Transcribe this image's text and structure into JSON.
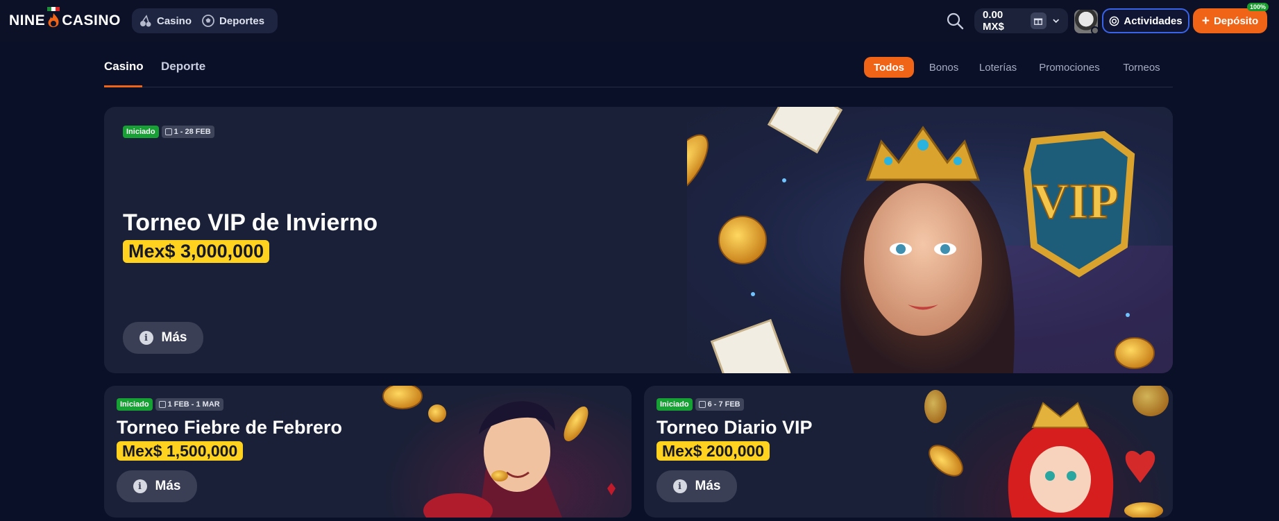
{
  "brand": {
    "logo_left": "NINE",
    "logo_right": "CASINO"
  },
  "topnav": {
    "casino": "Casino",
    "sports": "Deportes"
  },
  "header": {
    "balance": "0.00 MX$",
    "activities": "Actividades",
    "deposit": "Depósito",
    "deposit_badge": "100%"
  },
  "subnav": {
    "tabs": [
      "Casino",
      "Deporte"
    ],
    "filters": [
      "Todos",
      "Bonos",
      "Loterías",
      "Promociones",
      "Torneos"
    ],
    "active_filter": "Todos"
  },
  "cards": [
    {
      "status": "Iniciado",
      "dates": "1 - 28 FEB",
      "title": "Torneo VIP de Invierno",
      "prize": "Mex$ 3,000,000",
      "button": "Más"
    },
    {
      "status": "Iniciado",
      "dates": "1 FEB - 1 MAR",
      "title": "Torneo Fiebre de Febrero",
      "prize": "Mex$ 1,500,000",
      "button": "Más"
    },
    {
      "status": "Iniciado",
      "dates": "6 - 7 FEB",
      "title": "Torneo Diario VIP",
      "prize": "Mex$ 200,000",
      "button": "Más"
    }
  ],
  "hero_art": {
    "sign": "VIP"
  },
  "colors": {
    "accent": "#f06418",
    "background": "#0b1029",
    "card": "#1a2037",
    "prize": "#ffd21f",
    "live": "#17a033",
    "activity_border": "#3a64e8"
  }
}
